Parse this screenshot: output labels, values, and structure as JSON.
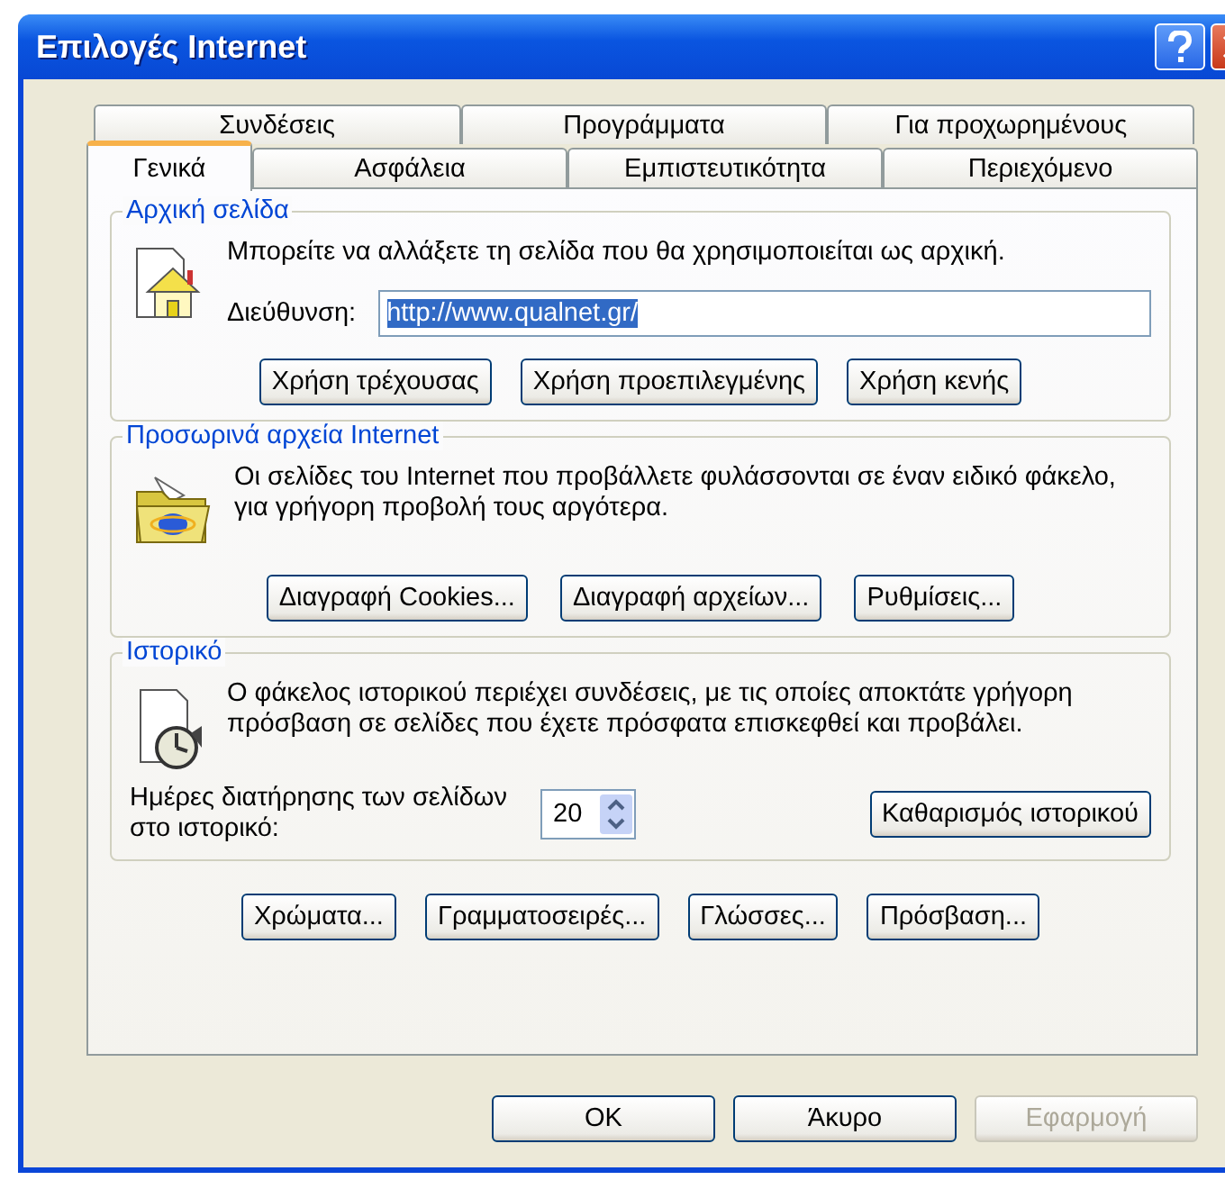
{
  "window": {
    "title": "Επιλογές Internet"
  },
  "tab_rows": [
    [
      {
        "label": "Συνδέσεις",
        "selected": false
      },
      {
        "label": "Προγράμματα",
        "selected": false
      },
      {
        "label": "Για προχωρημένους",
        "selected": false
      }
    ],
    [
      {
        "label": "Γενικά",
        "selected": true
      },
      {
        "label": "Ασφάλεια",
        "selected": false
      },
      {
        "label": "Εμπιστευτικότητα",
        "selected": false
      },
      {
        "label": "Περιεχόμενο",
        "selected": false
      }
    ]
  ],
  "home_page": {
    "title": "Αρχική σελίδα",
    "description": "Μπορείτε να αλλάξετε τη σελίδα που θα χρησιμοποιείται ως αρχική.",
    "address_label": "Διεύθυνση:",
    "address_value": "http://www.qualnet.gr/",
    "address_text_selected": true,
    "buttons": [
      "Χρήση τρέχουσας",
      "Χρήση προεπιλεγμένης",
      "Χρήση κενής"
    ]
  },
  "temporary_files": {
    "title": "Προσωρινά αρχεία Internet",
    "description": "Οι σελίδες του Internet που προβάλλετε φυλάσσονται σε έναν ειδικό φάκελο, για γρήγορη προβολή τους αργότερα.",
    "buttons": [
      "Διαγραφή Cookies...",
      "Διαγραφή αρχείων...",
      "Ρυθμίσεις..."
    ]
  },
  "history": {
    "title": "Ιστορικό",
    "description": "Ο φάκελος ιστορικού περιέχει συνδέσεις, με τις οποίες αποκτάτε γρήγορη πρόσβαση σε σελίδες που έχετε πρόσφατα επισκεφθεί και προβάλει.",
    "days_label": "Ημέρες διατήρησης των σελίδων στο ιστορικό:",
    "days_value": "20",
    "clear_button": "Καθαρισμός ιστορικού"
  },
  "bottom_buttons": [
    "Χρώματα...",
    "Γραμματοσειρές...",
    "Γλώσσες...",
    "Πρόσβαση..."
  ],
  "dialog_buttons": [
    {
      "label": "OK",
      "disabled": false
    },
    {
      "label": "Άκυρο",
      "disabled": false
    },
    {
      "label": "Εφαρμογή",
      "disabled": true
    }
  ]
}
